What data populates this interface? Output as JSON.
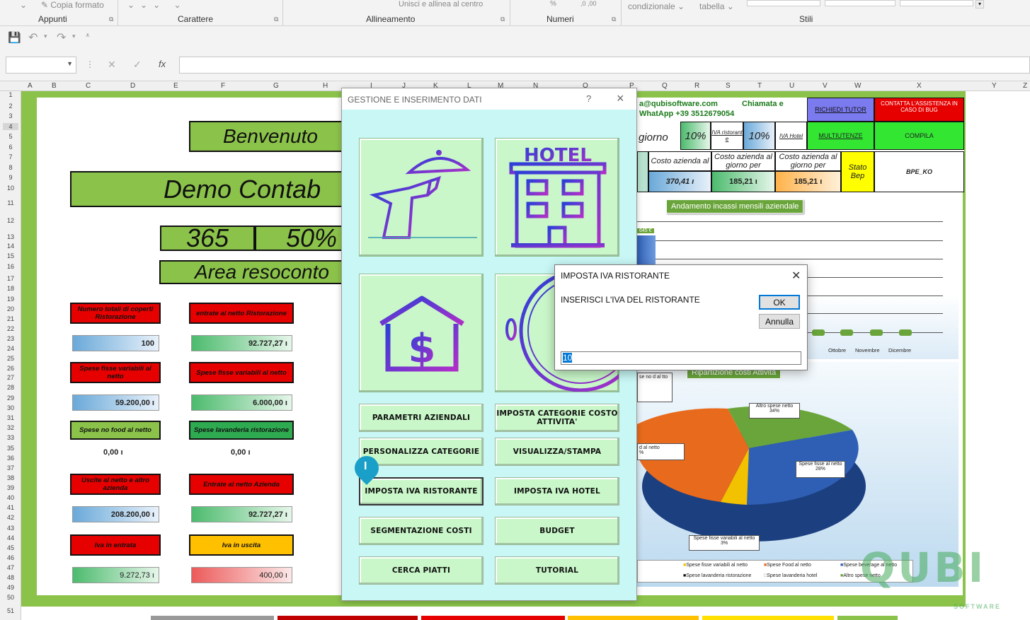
{
  "ribbon": {
    "copy_format": "Copia formato",
    "groups": [
      "Appunti",
      "Carattere",
      "Allineamento",
      "Numeri",
      "Stili"
    ],
    "merge_center": "Unisci e allinea al centro",
    "cond_format": "condizionale",
    "as_table": "tabella",
    "percent": "%",
    "decimals": ",0  ,00"
  },
  "formula_bar": {
    "name_box": "",
    "fx": "fx",
    "formula": ""
  },
  "columns": [
    "A",
    "B",
    "C",
    "D",
    "E",
    "F",
    "G",
    "H",
    "I",
    "J",
    "K",
    "L",
    "M",
    "N",
    "O",
    "P",
    "Q",
    "R",
    "S",
    "T",
    "U",
    "V",
    "W",
    "X",
    "Y",
    "Z"
  ],
  "rows": [
    "1",
    "2",
    "3",
    "4",
    "5",
    "6",
    "7",
    "8",
    "9",
    "10",
    "11",
    "12",
    "13",
    "14",
    "15",
    "16",
    "17",
    "18",
    "19",
    "20",
    "21",
    "22",
    "23",
    "24",
    "25",
    "26",
    "27",
    "28",
    "29",
    "30",
    "31",
    "32",
    "33",
    "35",
    "36",
    "37",
    "38",
    "39",
    "40",
    "41",
    "42",
    "43",
    "44",
    "45",
    "46",
    "47",
    "48",
    "49",
    "50",
    "51"
  ],
  "sheet": {
    "welcome": "Benvenuto",
    "title": "Demo Contab",
    "days": "365",
    "percent": "50%",
    "summary": "Area resoconto",
    "cells": [
      {
        "label": "Numero totali di coperti Ristorazione",
        "value": "100",
        "color": "#e60000",
        "grad": "g1"
      },
      {
        "label": "entrate al netto Ristorazione",
        "value": "92.727,27 ı",
        "color": "#e60000",
        "grad": "g2"
      },
      {
        "label": "Spese fisse variabili al netto",
        "value": "59.200,00 ı",
        "color": "#e60000",
        "grad": "g1"
      },
      {
        "label": "Spese fisse variabili al netto",
        "value": "6.000,00 ı",
        "color": "#e60000",
        "grad": "g2"
      },
      {
        "label": "Spese no food al netto",
        "value": "0,00 ı",
        "color": "#8bc34a",
        "grad": ""
      },
      {
        "label": "Spese lavanderia ristorazione",
        "value": "0,00 ı",
        "color": "#2eaa50",
        "grad": ""
      },
      {
        "label": "Uscite al netto e altro azienda",
        "value": "208.200,00 ı",
        "color": "#e60000",
        "grad": "g1"
      },
      {
        "label": "Entrate al netto Azienda",
        "value": "92.727,27 ı",
        "color": "#e60000",
        "grad": "g2"
      },
      {
        "label": "Iva in entrata",
        "value": "9.272,73 ı",
        "color": "#e60000",
        "grad": "g2"
      },
      {
        "label": "Iva in uscita",
        "value": "400,00 ı",
        "color": "#ffc000",
        "grad": "g3"
      }
    ]
  },
  "right_panel": {
    "email": "a@qubisoftware.com",
    "call": "Chiamata e",
    "whatsapp": "WhatApp  +39 3512679054",
    "tutor": "RICHIEDI TUTOR",
    "support": "CONTATTA L'ASSISTENZA IN CASO DI BUG",
    "giorno": "giorno",
    "iva1": "10%",
    "iva_rist": "IVA ristorant e",
    "iva2": "10%",
    "iva_hotel": "IVA Hotel",
    "multiutenze": "MULTIUTENZE",
    "compila": "COMPILA",
    "costo1": "Costo azienda al",
    "costo2": "Costo azienda al giorno per",
    "costo3": "Costo azienda al giorno per",
    "stato": "Stato Bep",
    "bpe": "BPE_KO",
    "v1": "370,41 ı",
    "v2": "185,21 ı",
    "v3": "185,21 ı"
  },
  "chart_data": [
    {
      "type": "bar",
      "title": "Andamento incassi mensili aziendale",
      "categories": [
        "Ottobre",
        "Novembre",
        "Dicembre"
      ],
      "visible_label": "645 €",
      "note": "partially hidden by dialog"
    },
    {
      "type": "pie",
      "title": "Ripartizione costi Attività",
      "slices": [
        {
          "label": "Altro spese netto",
          "value": 34
        },
        {
          "label": "Spese fisse al netto",
          "value": 28
        },
        {
          "label": "Spese fisse variabili al netto",
          "value": 3
        },
        {
          "label": "Spese Food al netto",
          "value": 35
        }
      ],
      "legend": [
        "Spese fisse variabili al netto",
        "Spese Food al netto",
        "Spese beverage al netto",
        "Spese lavanderia ristorazione",
        "Spese lavanderia hotel",
        "Altro spese netto"
      ],
      "label_texts": {
        "altro": "Altro spese netto",
        "altro_pct": "34%",
        "fisse": "Spese fisse al netto",
        "fisse_pct": "28%",
        "variabili": "Spese fisse variabili al netto",
        "variabili_pct": "3%",
        "food_partial": "d al netto",
        "food_pct": "%",
        "nofood_partial": "se no d al tto"
      },
      "colors": {
        "blue": "#2f5fb4",
        "orange": "#e86a1c",
        "green": "#6aa53b",
        "yellow": "#f2c200"
      }
    }
  ],
  "form": {
    "title": "GESTIONE E INSERIMENTO DATI",
    "help": "?",
    "close": "×",
    "buttons": [
      "PARAMETRI AZIENDALI",
      "IMPOSTA CATEGORIE COSTO ATTIVITA'",
      "PERSONALIZZA CATEGORIE",
      "VISUALIZZA/STAMPA",
      "IMPOSTA IVA RISTORANTE",
      "IMPOSTA IVA HOTEL",
      "SEGMENTAZIONE COSTI",
      "BUDGET",
      "CERCA PIATTI",
      "TUTORIAL"
    ],
    "hotel_sign": "HOTEL",
    "pin": "I"
  },
  "dialog": {
    "title": "IMPOSTA IVA RISTORANTE",
    "prompt": "INSERISCI L'IVA DEL RISTORANTE",
    "ok": "OK",
    "cancel": "Annulla",
    "input": "10"
  },
  "logo": {
    "text": "QUBI",
    "sub": "SOFTWARE"
  }
}
